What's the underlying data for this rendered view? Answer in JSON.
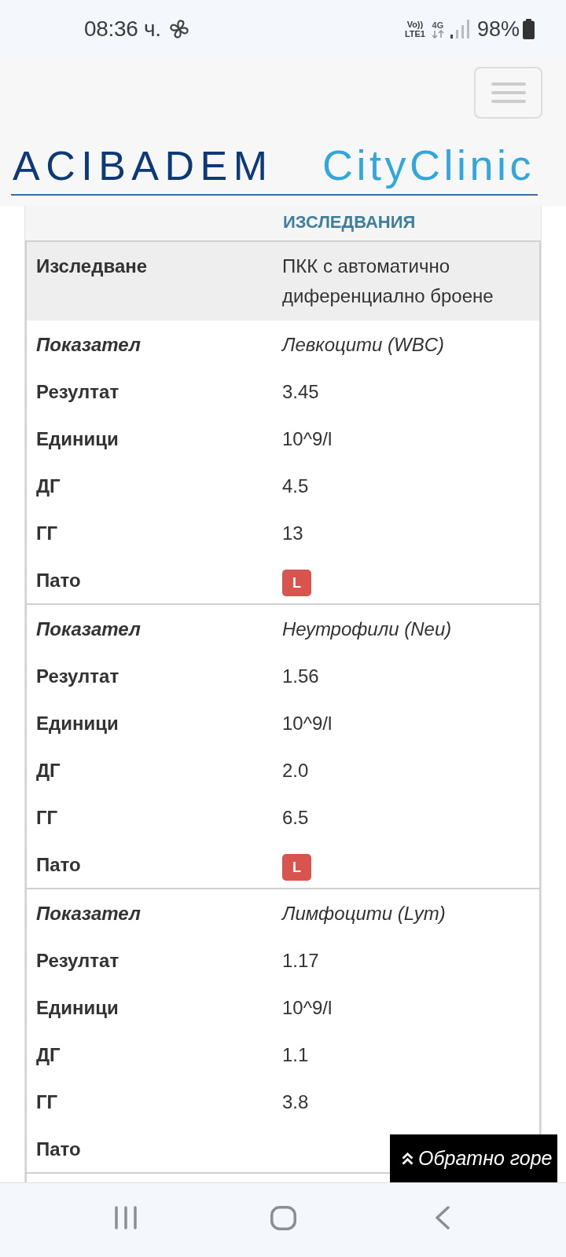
{
  "status_bar": {
    "time": "08:36 ч.",
    "volte": "Vo))",
    "lte": "LTE1",
    "network": "4G",
    "battery": "98%"
  },
  "header": {
    "logo_primary": "ACIBADEM",
    "logo_secondary": "CityClinic"
  },
  "report": {
    "section_title": "ИЗСЛЕДВАНИЯ",
    "test": {
      "label": "Изследване",
      "value": "ПКК с автоматично диференциално броене"
    },
    "groups": [
      {
        "rows": [
          {
            "kind": "name",
            "label": "Показател",
            "value": "Левкоцити (WBC)"
          },
          {
            "kind": "text",
            "label": "Резултат",
            "value": "3.45"
          },
          {
            "kind": "text",
            "label": "Единици",
            "value": "10^9/l"
          },
          {
            "kind": "text",
            "label": "ДГ",
            "value": "4.5"
          },
          {
            "kind": "text",
            "label": "ГГ",
            "value": "13"
          },
          {
            "kind": "flag",
            "label": "Пато",
            "value": "L"
          }
        ]
      },
      {
        "rows": [
          {
            "kind": "name",
            "label": "Показател",
            "value": "Неутрофили (Neu)"
          },
          {
            "kind": "text",
            "label": "Резултат",
            "value": "1.56"
          },
          {
            "kind": "text",
            "label": "Единици",
            "value": "10^9/l"
          },
          {
            "kind": "text",
            "label": "ДГ",
            "value": "2.0"
          },
          {
            "kind": "text",
            "label": "ГГ",
            "value": "6.5"
          },
          {
            "kind": "flag",
            "label": "Пато",
            "value": "L"
          }
        ]
      },
      {
        "rows": [
          {
            "kind": "name",
            "label": "Показател",
            "value": "Лимфоцити (Lym)"
          },
          {
            "kind": "text",
            "label": "Резултат",
            "value": "1.17"
          },
          {
            "kind": "text",
            "label": "Единици",
            "value": "10^9/l"
          },
          {
            "kind": "text",
            "label": "ДГ",
            "value": "1.1"
          },
          {
            "kind": "text",
            "label": "ГГ",
            "value": "3.8"
          },
          {
            "kind": "flag",
            "label": "Пато"
          }
        ]
      }
    ]
  },
  "back_to_top": {
    "label": "Обратно горе"
  }
}
